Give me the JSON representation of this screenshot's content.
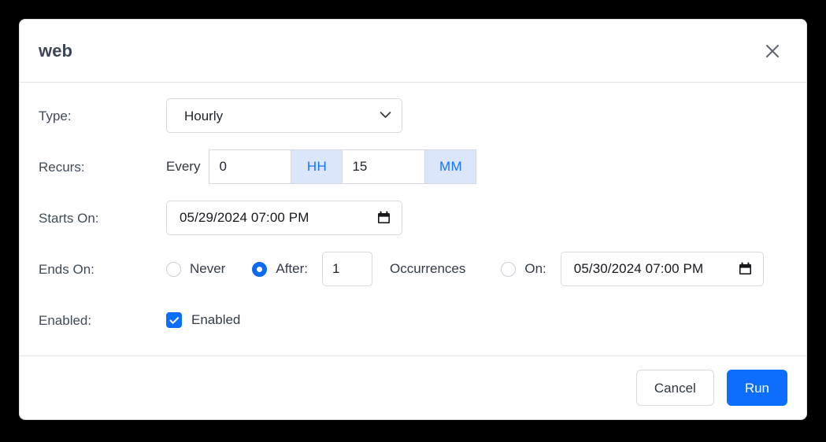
{
  "dialog": {
    "title": "web",
    "close_icon": "close-icon"
  },
  "fields": {
    "type": {
      "label": "Type:",
      "selected": "Hourly",
      "options": [
        "Hourly"
      ]
    },
    "recurs": {
      "label": "Recurs:",
      "every_label": "Every",
      "hours_value": "0",
      "hours_addon": "HH",
      "minutes_value": "15",
      "minutes_addon": "MM"
    },
    "starts_on": {
      "label": "Starts On:",
      "value": "05/29/2024 07:00 PM",
      "icon": "calendar-icon"
    },
    "ends_on": {
      "label": "Ends On:",
      "never_label": "Never",
      "never_selected": false,
      "after_label": "After:",
      "after_selected": true,
      "occurrences_value": "1",
      "occurrences_label": "Occurrences",
      "on_label": "On:",
      "on_selected": false,
      "on_value": "05/30/2024 07:00 PM",
      "on_icon": "calendar-icon"
    },
    "enabled": {
      "label": "Enabled:",
      "checkbox_label": "Enabled",
      "checked": true
    }
  },
  "footer": {
    "cancel_label": "Cancel",
    "run_label": "Run"
  },
  "colors": {
    "primary": "#0d6efd",
    "addon_bg": "#dbe5fb",
    "addon_text": "#1a73ff",
    "title_text": "#3c4657",
    "label_text": "#3f4a5a",
    "border": "#d6dae0",
    "backdrop": "#000000"
  }
}
